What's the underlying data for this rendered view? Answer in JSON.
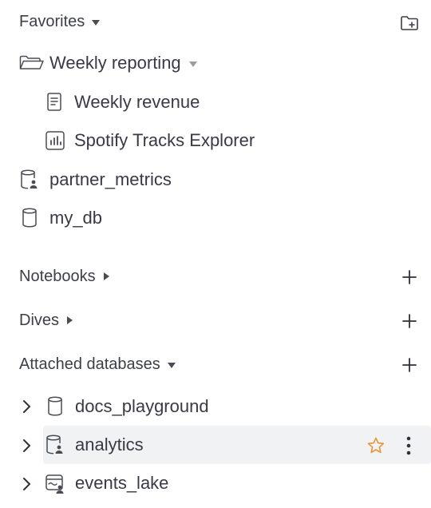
{
  "favorites": {
    "title": "Favorites",
    "new_folder_icon": "folder-plus-icon",
    "folder": {
      "label": "Weekly reporting",
      "icon": "folder-open-icon"
    },
    "items": [
      {
        "label": "Weekly revenue",
        "icon": "document-icon"
      },
      {
        "label": "Spotify Tracks Explorer",
        "icon": "chart-icon"
      }
    ],
    "databases": [
      {
        "label": "partner_metrics",
        "icon": "shared-database-icon"
      },
      {
        "label": "my_db",
        "icon": "database-icon"
      }
    ]
  },
  "notebooks": {
    "title": "Notebooks",
    "add_icon": "plus-icon"
  },
  "dives": {
    "title": "Dives",
    "add_icon": "plus-icon"
  },
  "attached_databases": {
    "title": "Attached databases",
    "add_icon": "plus-icon",
    "items": [
      {
        "label": "docs_playground",
        "icon": "database-icon"
      },
      {
        "label": "analytics",
        "icon": "shared-database-icon",
        "hovered": true
      },
      {
        "label": "events_lake",
        "icon": "shared-lake-icon"
      }
    ]
  },
  "colors": {
    "star": "#e8943a",
    "text": "#383a46",
    "hover_bg": "#f1f2f4"
  }
}
